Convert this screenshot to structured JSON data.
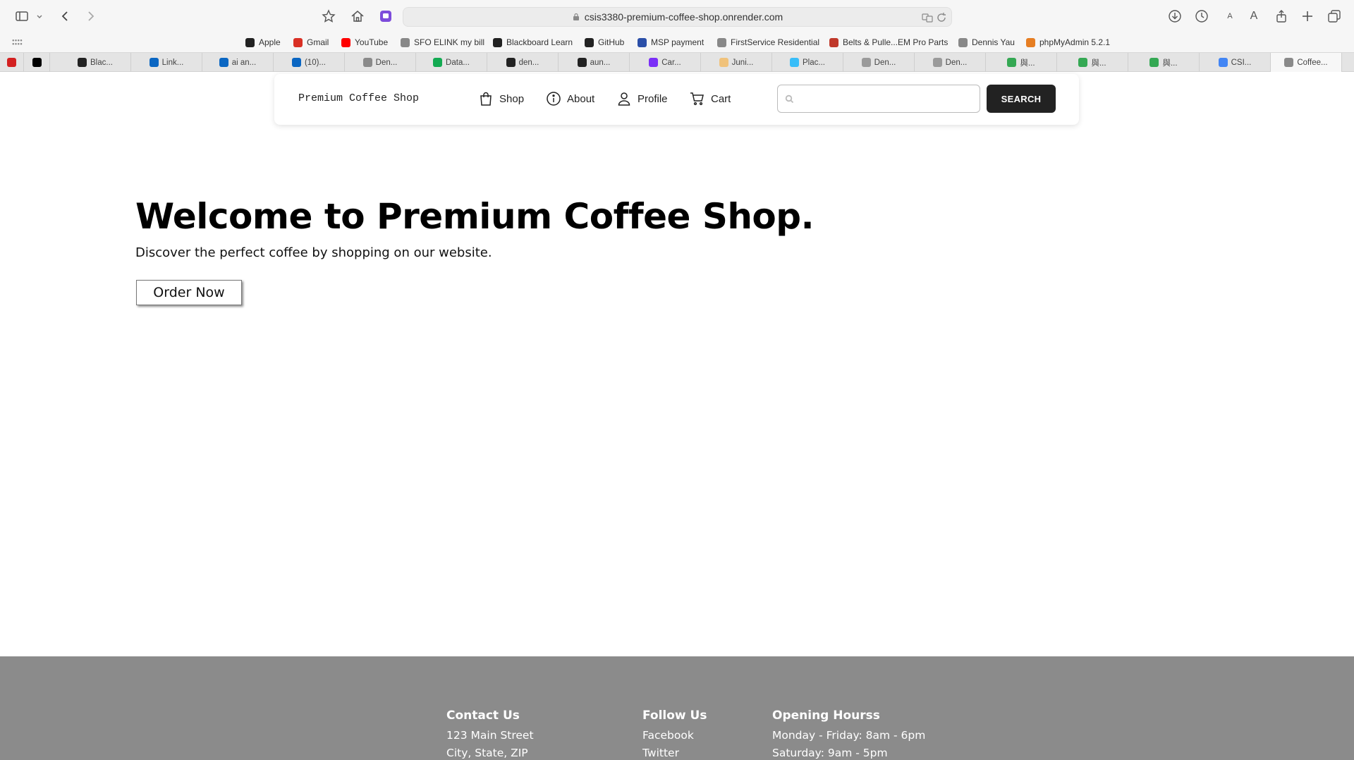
{
  "browser": {
    "url": "csis3380-premium-coffee-shop.onrender.com",
    "favorites": [
      {
        "label": "Apple",
        "color": "#222222"
      },
      {
        "label": "Gmail",
        "color": "#d93025"
      },
      {
        "label": "YouTube",
        "color": "#ff0000"
      },
      {
        "label": "SFO ELINK my bill",
        "color": "#888888"
      },
      {
        "label": "Blackboard Learn",
        "color": "#222222"
      },
      {
        "label": "GitHub",
        "color": "#222222"
      },
      {
        "label": "MSP payment",
        "color": "#2b4fa8"
      },
      {
        "label": "FirstService Residential",
        "color": "#888888"
      },
      {
        "label": "Belts & Pulle...EM Pro Parts",
        "color": "#c0392b"
      },
      {
        "label": "Dennis Yau",
        "color": "#888888"
      },
      {
        "label": "phpMyAdmin 5.2.1",
        "color": "#e67e22"
      }
    ],
    "tabs": [
      {
        "label": "",
        "color": "#d32020"
      },
      {
        "label": "",
        "color": "#000000"
      },
      {
        "label": "Blac...",
        "color": "#222222"
      },
      {
        "label": "Link...",
        "color": "#0a66c2"
      },
      {
        "label": "ai an...",
        "color": "#0a66c2"
      },
      {
        "label": "(10)...",
        "color": "#0a66c2"
      },
      {
        "label": "Den...",
        "color": "#8a8a8a"
      },
      {
        "label": "Data...",
        "color": "#13aa52"
      },
      {
        "label": "den...",
        "color": "#222222"
      },
      {
        "label": "aun...",
        "color": "#222222"
      },
      {
        "label": "Car...",
        "color": "#7b2ff7"
      },
      {
        "label": "Juni...",
        "color": "#f0c27b"
      },
      {
        "label": "Plac...",
        "color": "#38bdf8"
      },
      {
        "label": "Den...",
        "color": "#9a9a9a"
      },
      {
        "label": "Den...",
        "color": "#9a9a9a"
      },
      {
        "label": "與...",
        "color": "#34a853"
      },
      {
        "label": "與...",
        "color": "#34a853"
      },
      {
        "label": "與...",
        "color": "#34a853"
      },
      {
        "label": "CSI...",
        "color": "#4285f4"
      },
      {
        "label": "Coffee...",
        "color": "#8a8a8a"
      }
    ]
  },
  "nav": {
    "brand": "Premium Coffee Shop",
    "links": {
      "shop": "Shop",
      "about": "About",
      "profile": "Profile",
      "cart": "Cart"
    },
    "search_placeholder": "",
    "search_button": "SEARCH"
  },
  "hero": {
    "title": "Welcome to Premium Coffee Shop.",
    "subtitle": "Discover the perfect coffee by shopping on our website.",
    "cta": "Order Now"
  },
  "footer": {
    "contact": {
      "heading": "Contact Us",
      "lines": [
        "123 Main Street",
        "City, State, ZIP"
      ]
    },
    "follow": {
      "heading": "Follow Us",
      "lines": [
        "Facebook",
        "Twitter"
      ]
    },
    "hours": {
      "heading": "Opening Hourss",
      "lines": [
        "Monday - Friday: 8am - 6pm",
        "Saturday: 9am - 5pm"
      ]
    }
  }
}
